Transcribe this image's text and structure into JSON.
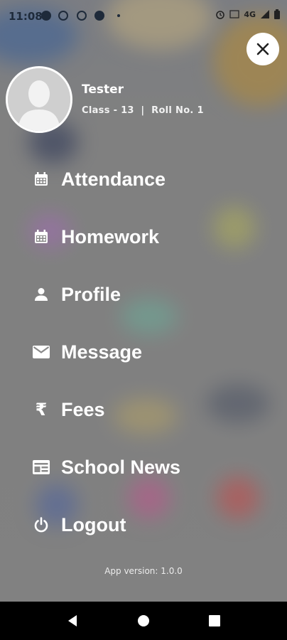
{
  "status_bar": {
    "time": "11:08",
    "network": "4G"
  },
  "close_button": {
    "icon": "close-icon"
  },
  "profile": {
    "name": "Tester",
    "class_roll": "Class - 13  |  Roll No. 1"
  },
  "menu": [
    {
      "label": "Attendance",
      "icon": "calendar-icon"
    },
    {
      "label": "Homework",
      "icon": "calendar-icon"
    },
    {
      "label": "Profile",
      "icon": "person-icon"
    },
    {
      "label": "Message",
      "icon": "mail-icon"
    },
    {
      "label": "Fees",
      "icon": "rupee-icon"
    },
    {
      "label": "School News",
      "icon": "news-icon"
    },
    {
      "label": "Logout",
      "icon": "power-icon"
    }
  ],
  "app_version": "App version: 1.0.0",
  "navigation_bar": {
    "back": "back-icon",
    "home": "home-icon",
    "recents": "recents-icon"
  }
}
